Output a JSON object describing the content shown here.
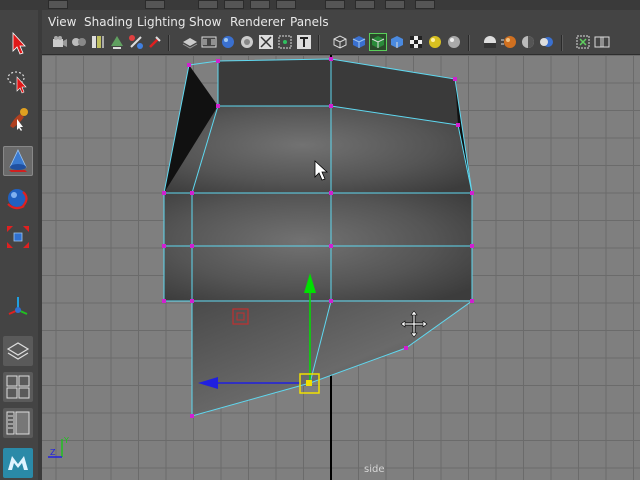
{
  "menu": {
    "view": "View",
    "shading": "Shading",
    "lighting": "Lighting",
    "show": "Show",
    "renderer": "Renderer",
    "panels": "Panels"
  },
  "toolbox": {
    "tools": [
      "select-tool",
      "lasso-tool",
      "paint-select-tool",
      "move-tool",
      "rotate-tool",
      "scale-tool",
      "show-manipulator-tool"
    ],
    "active_tool": "move-tool"
  },
  "panel_toolbar": {
    "icons": [
      "camera-icon",
      "camera-attributes-icon",
      "bookmarks-icon",
      "image-plane-icon",
      "2d-pan-zoom-icon",
      "grid-icon",
      "film-gate-icon",
      "resolution-gate-icon",
      "gate-mask-icon",
      "field-chart-icon",
      "safe-action-icon",
      "safe-title-icon",
      "wireframe-icon",
      "smooth-shade-icon",
      "wireframe-on-shaded-icon",
      "default-material-icon",
      "textured-icon",
      "use-all-lights-icon",
      "shadows-icon",
      "screen-space-ambient-occlusion-icon",
      "motion-blur-icon",
      "multisample-aa-icon",
      "depth-of-field-icon",
      "isolate-select-icon",
      "xray-icon"
    ]
  },
  "viewport": {
    "camera_label": "side",
    "background_color": "#7f7f7f",
    "grid_color": "#6b6b6b",
    "axis_color": "#000000",
    "wire_color": "#5fd8f0",
    "vertex_color": "#d020d0",
    "manip_y_color": "#00e000",
    "manip_z_color": "#2020e0",
    "manip_center_color": "#f0e000",
    "pivot_color": "#c03030"
  },
  "axis_indicator": {
    "y": "Y",
    "z": "Z"
  },
  "logo": {
    "text": "MAYA"
  }
}
